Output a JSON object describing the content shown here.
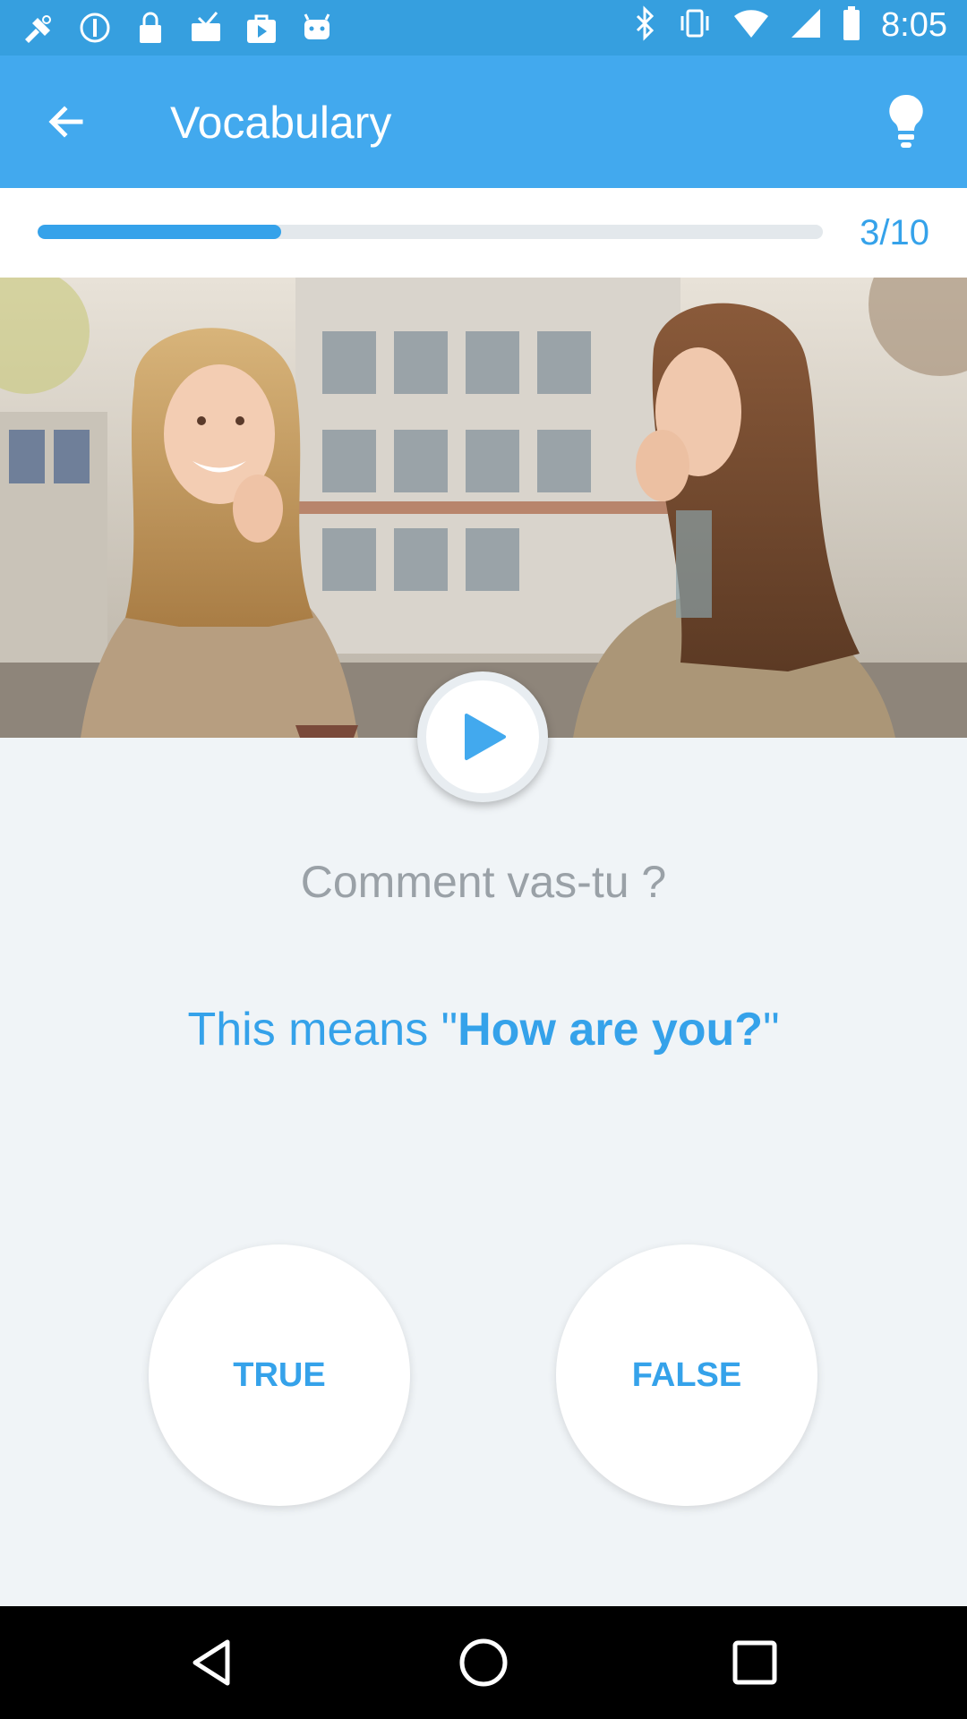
{
  "status_bar": {
    "time": "8:05",
    "icons": [
      "fake-gps-icon",
      "data-saver-icon",
      "lock-icon",
      "inbox-icon",
      "play-store-icon",
      "android-icon"
    ],
    "right_icons": [
      "bluetooth-icon",
      "vibrate-icon",
      "wifi-icon",
      "signal-icon",
      "battery-icon"
    ]
  },
  "app_bar": {
    "title": "Vocabulary",
    "back_icon": "arrow-back-icon",
    "hint_icon": "lightbulb-icon"
  },
  "progress": {
    "current": 3,
    "total": 10,
    "label": "3/10",
    "fill_fraction": 0.31
  },
  "lesson": {
    "image_description_icon": "photo",
    "play_icon": "play-icon",
    "phrase": "Comment vas-tu ?",
    "meaning_prefix": "This means \"",
    "meaning_highlight": "How are you?",
    "meaning_suffix": "\""
  },
  "answers": {
    "true_label": "TRUE",
    "false_label": "FALSE"
  },
  "colors": {
    "app_bar": "#42a9ee",
    "status_bar": "#369fdf",
    "accent": "#35a2ea",
    "background": "#f0f4f7"
  }
}
